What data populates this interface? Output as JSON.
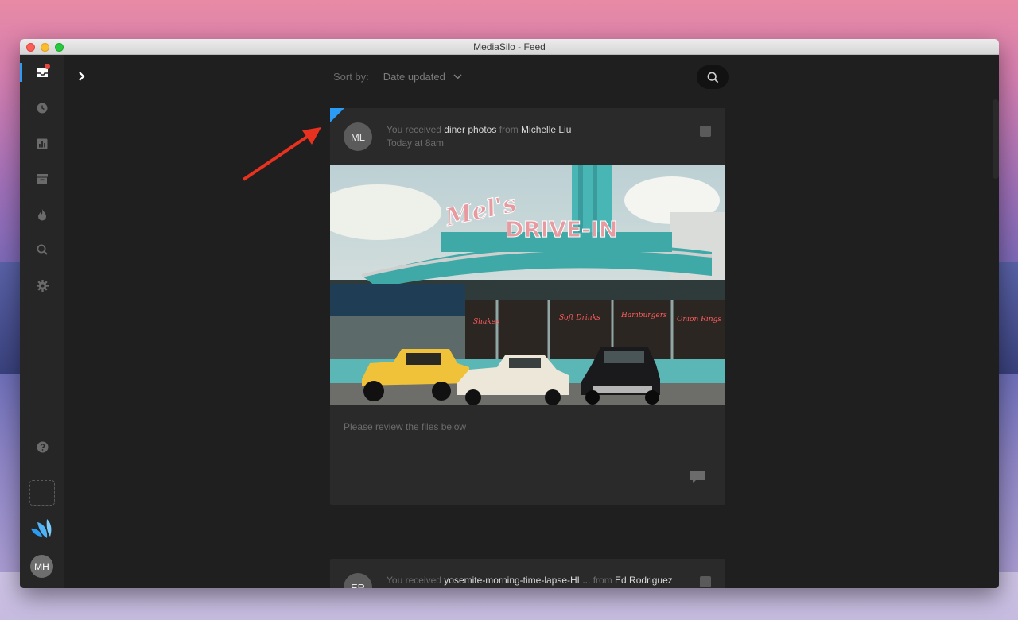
{
  "window": {
    "title": "MediaSilo - Feed"
  },
  "sidebar": {
    "items": [
      {
        "name": "inbox",
        "icon": "inbox-icon"
      },
      {
        "name": "recent",
        "icon": "clock-icon"
      },
      {
        "name": "analytics",
        "icon": "bar-chart-icon"
      },
      {
        "name": "archive",
        "icon": "archive-icon"
      },
      {
        "name": "trending",
        "icon": "flame-icon"
      },
      {
        "name": "search",
        "icon": "search-icon"
      },
      {
        "name": "settings",
        "icon": "gear-icon"
      }
    ],
    "user_initials": "MH"
  },
  "toolbar": {
    "sort_label": "Sort by:",
    "sort_value": "Date updated"
  },
  "feed": [
    {
      "initials": "ML",
      "prefix": "You received",
      "item": "diner photos",
      "from_word": "from",
      "sender": "Michelle Liu",
      "time": "Today at 8am",
      "message": "Please review the files below",
      "sign_text_1": "Mel's",
      "sign_text_2": "DRIVE-IN"
    },
    {
      "initials": "ER",
      "prefix": "You received",
      "item": "yosemite-morning-time-lapse-HL...",
      "from_word": "from",
      "sender": "Ed Rodriguez"
    }
  ],
  "colors": {
    "accent": "#2b9bf4",
    "notification": "#e8453c",
    "annotation_arrow": "#e8321f"
  }
}
